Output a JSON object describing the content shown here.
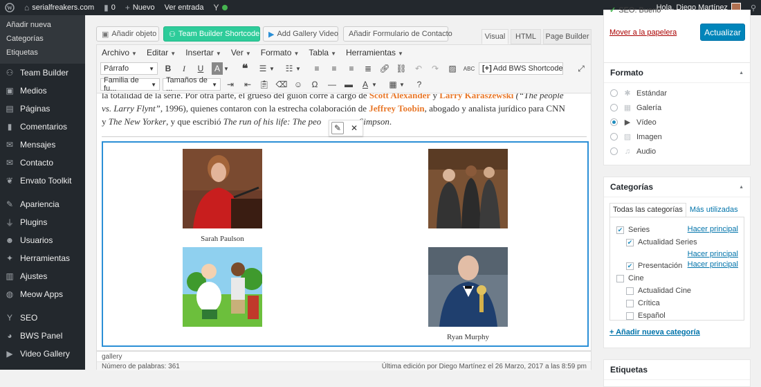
{
  "adminbar": {
    "site_name": "serialfreakers.com",
    "comments_count": "0",
    "new_label": "Nuevo",
    "view_post": "Ver entrada",
    "greeting": "Hola, Diego Martínez"
  },
  "menu": {
    "submenu": [
      "Añadir nueva",
      "Categorías",
      "Etiquetas"
    ],
    "items": [
      {
        "label": "Team Builder",
        "icon": "team-icon"
      },
      {
        "label": "Medios",
        "icon": "media-icon"
      },
      {
        "label": "Páginas",
        "icon": "page-icon"
      },
      {
        "label": "Comentarios",
        "icon": "comment-icon"
      },
      {
        "label": "Mensajes",
        "icon": "message-icon"
      },
      {
        "label": "Contacto",
        "icon": "mail-icon"
      },
      {
        "label": "Envato Toolkit",
        "icon": "leaf-icon"
      },
      {
        "label": "Apariencia",
        "icon": "brush-icon"
      },
      {
        "label": "Plugins",
        "icon": "plug-icon"
      },
      {
        "label": "Usuarios",
        "icon": "user-icon"
      },
      {
        "label": "Herramientas",
        "icon": "wrench-icon"
      },
      {
        "label": "Ajustes",
        "icon": "settings-icon"
      },
      {
        "label": "Meow Apps",
        "icon": "meow-icon"
      },
      {
        "label": "SEO",
        "icon": "seo-icon"
      },
      {
        "label": "BWS Panel",
        "icon": "bws-icon"
      },
      {
        "label": "Video Gallery",
        "icon": "video-icon"
      }
    ]
  },
  "editor": {
    "media_buttons": {
      "add_object": "Añadir objeto",
      "team_builder": "Team Builder Shortcode",
      "add_gallery_video": "Add Gallery Video",
      "add_contact_form": "Añadir Formulario de Contacto"
    },
    "tabs": {
      "visual": "Visual",
      "html": "HTML",
      "page_builder": "Page Builder"
    },
    "menubar": [
      "Archivo",
      "Editar",
      "Insertar",
      "Ver",
      "Formato",
      "Tabla",
      "Herramientas"
    ],
    "format_select": "Párrafo",
    "font_family": "Familia de fu...",
    "font_size": "Tamaños de ...",
    "bws_shortcode": "Add BWS Shortcode",
    "paragraph": {
      "l1a": "la totalidad de la serie. Por otra parte, el grueso del guión corre a cargo de ",
      "n1": "Scott Alexander",
      "l1b": " y ",
      "n2": "Larry Karaszewski",
      "l1c": " (“The people",
      "l2a": "vs. Larry Flynt”",
      "l2b": ", 1996), quienes contaron con la estrecha colaboración de ",
      "n3": "Jeffrey Toobin",
      "l2c": ", abogado y analista jurídico para CNN",
      "l3a": "y ",
      "l3b": "The New Yorker",
      "l3c": ", y que escribió ",
      "l3d": "The run of his life: The peo",
      "l3e": ". Simpson",
      "l3f": "."
    },
    "gallery": [
      {
        "caption": "Sarah Paulson"
      },
      {
        "caption": ""
      },
      {
        "caption": ""
      },
      {
        "caption": "Ryan Murphy"
      }
    ],
    "path": "gallery",
    "word_count": "Número de palabras: 361",
    "last_edit": "Última edición por Diego Martínez el 26 Marzo, 2017 a las 8:59 pm"
  },
  "publish": {
    "seo": "SEO: Bueno",
    "trash": "Mover a la papelera",
    "update": "Actualizar"
  },
  "format_box": {
    "title": "Formato",
    "options": [
      {
        "label": "Estándar",
        "icon": "pin-icon",
        "selected": false
      },
      {
        "label": "Galería",
        "icon": "gallery-icon",
        "selected": false
      },
      {
        "label": "Vídeo",
        "icon": "video-icon",
        "selected": true
      },
      {
        "label": "Imagen",
        "icon": "image-icon",
        "selected": false
      },
      {
        "label": "Audio",
        "icon": "audio-icon",
        "selected": false
      }
    ]
  },
  "categories_box": {
    "title": "Categorías",
    "tab_all": "Todas las categorías",
    "tab_used": "Más utilizadas",
    "make_primary": "Hacer principal",
    "items": [
      {
        "label": "Series",
        "checked": true
      },
      {
        "label": "Actualidad Series",
        "checked": true
      },
      {
        "label": "Presentación",
        "checked": true
      },
      {
        "label": "Cine",
        "checked": false
      },
      {
        "label": "Actualidad Cine",
        "checked": false
      },
      {
        "label": "Crítica",
        "checked": false
      },
      {
        "label": "Español",
        "checked": false
      }
    ],
    "add_new": "+ Añadir nueva categoría"
  },
  "tags_box": {
    "title": "Etiquetas"
  }
}
